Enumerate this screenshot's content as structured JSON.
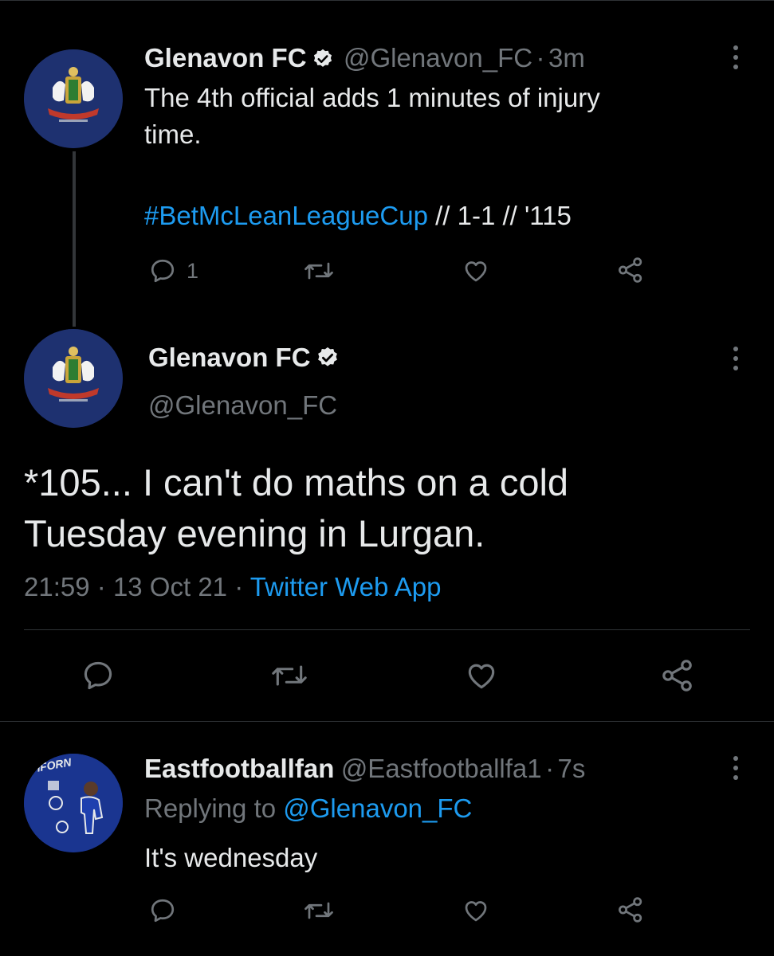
{
  "tweet1": {
    "name": "Glenavon FC",
    "handle": "@Glenavon_FC",
    "sep": "·",
    "time": "3m",
    "text_line1": "The 4th official adds 1 minutes of injury",
    "text_line2": "time.",
    "hashtag": "#BetMcLeanLeagueCup",
    "rest": " // 1-1 // '115",
    "reply_count": "1",
    "avatar_icon": "glenavon-crest"
  },
  "main_tweet": {
    "name": "Glenavon FC",
    "handle": "@Glenavon_FC",
    "text_line1": "*105... I can't do maths on a cold",
    "text_line2": "Tuesday evening in Lurgan.",
    "time": "21:59",
    "sep1": "·",
    "date": "13 Oct 21",
    "sep2": "·",
    "source": "Twitter Web App",
    "avatar_icon": "glenavon-crest"
  },
  "reply": {
    "name": "Eastfootballfan",
    "handle": "@Eastfootballfa1",
    "sep": "·",
    "time": "7s",
    "replying_prefix": "Replying to ",
    "replying_to": "@Glenavon_FC",
    "text": "It's wednesday",
    "avatar_text": "IFORN",
    "avatar_icon": "football-player-avatar"
  },
  "colors": {
    "background": "#000000",
    "text": "#e7e9ea",
    "secondary": "#71767b",
    "link": "#1d9bf0",
    "divider": "#2f3336"
  }
}
